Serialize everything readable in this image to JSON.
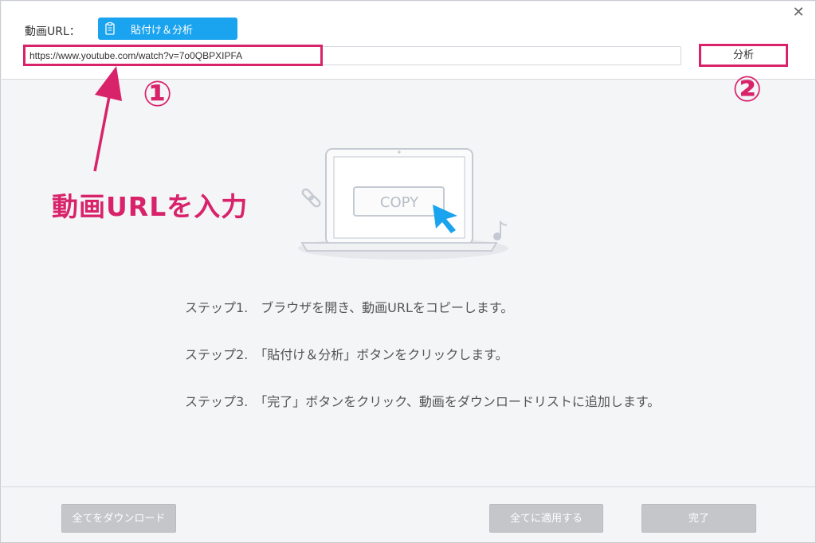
{
  "header": {
    "url_label": "動画URL：",
    "paste_button": "貼付け＆分析",
    "url_value": "https://www.youtube.com/watch?v=7o0QBPXIPFA",
    "analyze_button": "分析",
    "close_symbol": "✕"
  },
  "annotations": {
    "num1": "①",
    "num2": "②",
    "instruction": "動画URLを入力",
    "color": "#d8236b"
  },
  "illustration": {
    "copy_label": "COPY",
    "icons": [
      "laptop-icon",
      "link-icon",
      "cursor-icon",
      "music-note-icon"
    ]
  },
  "steps": [
    "ステップ1.　ブラウザを開き、動画URLをコピーします。",
    "ステップ2.　「貼付け＆分析」ボタンをクリックします。",
    "ステップ3.　「完了」ボタンをクリック、動画をダウンロードリストに追加します。"
  ],
  "footer": {
    "download_all": "全てをダウンロード",
    "apply_all": "全てに適用する",
    "done": "完了"
  },
  "colors": {
    "accent": "#1aa3ee",
    "annotation": "#d8236b",
    "disabled_button": "#c4c6c9"
  }
}
